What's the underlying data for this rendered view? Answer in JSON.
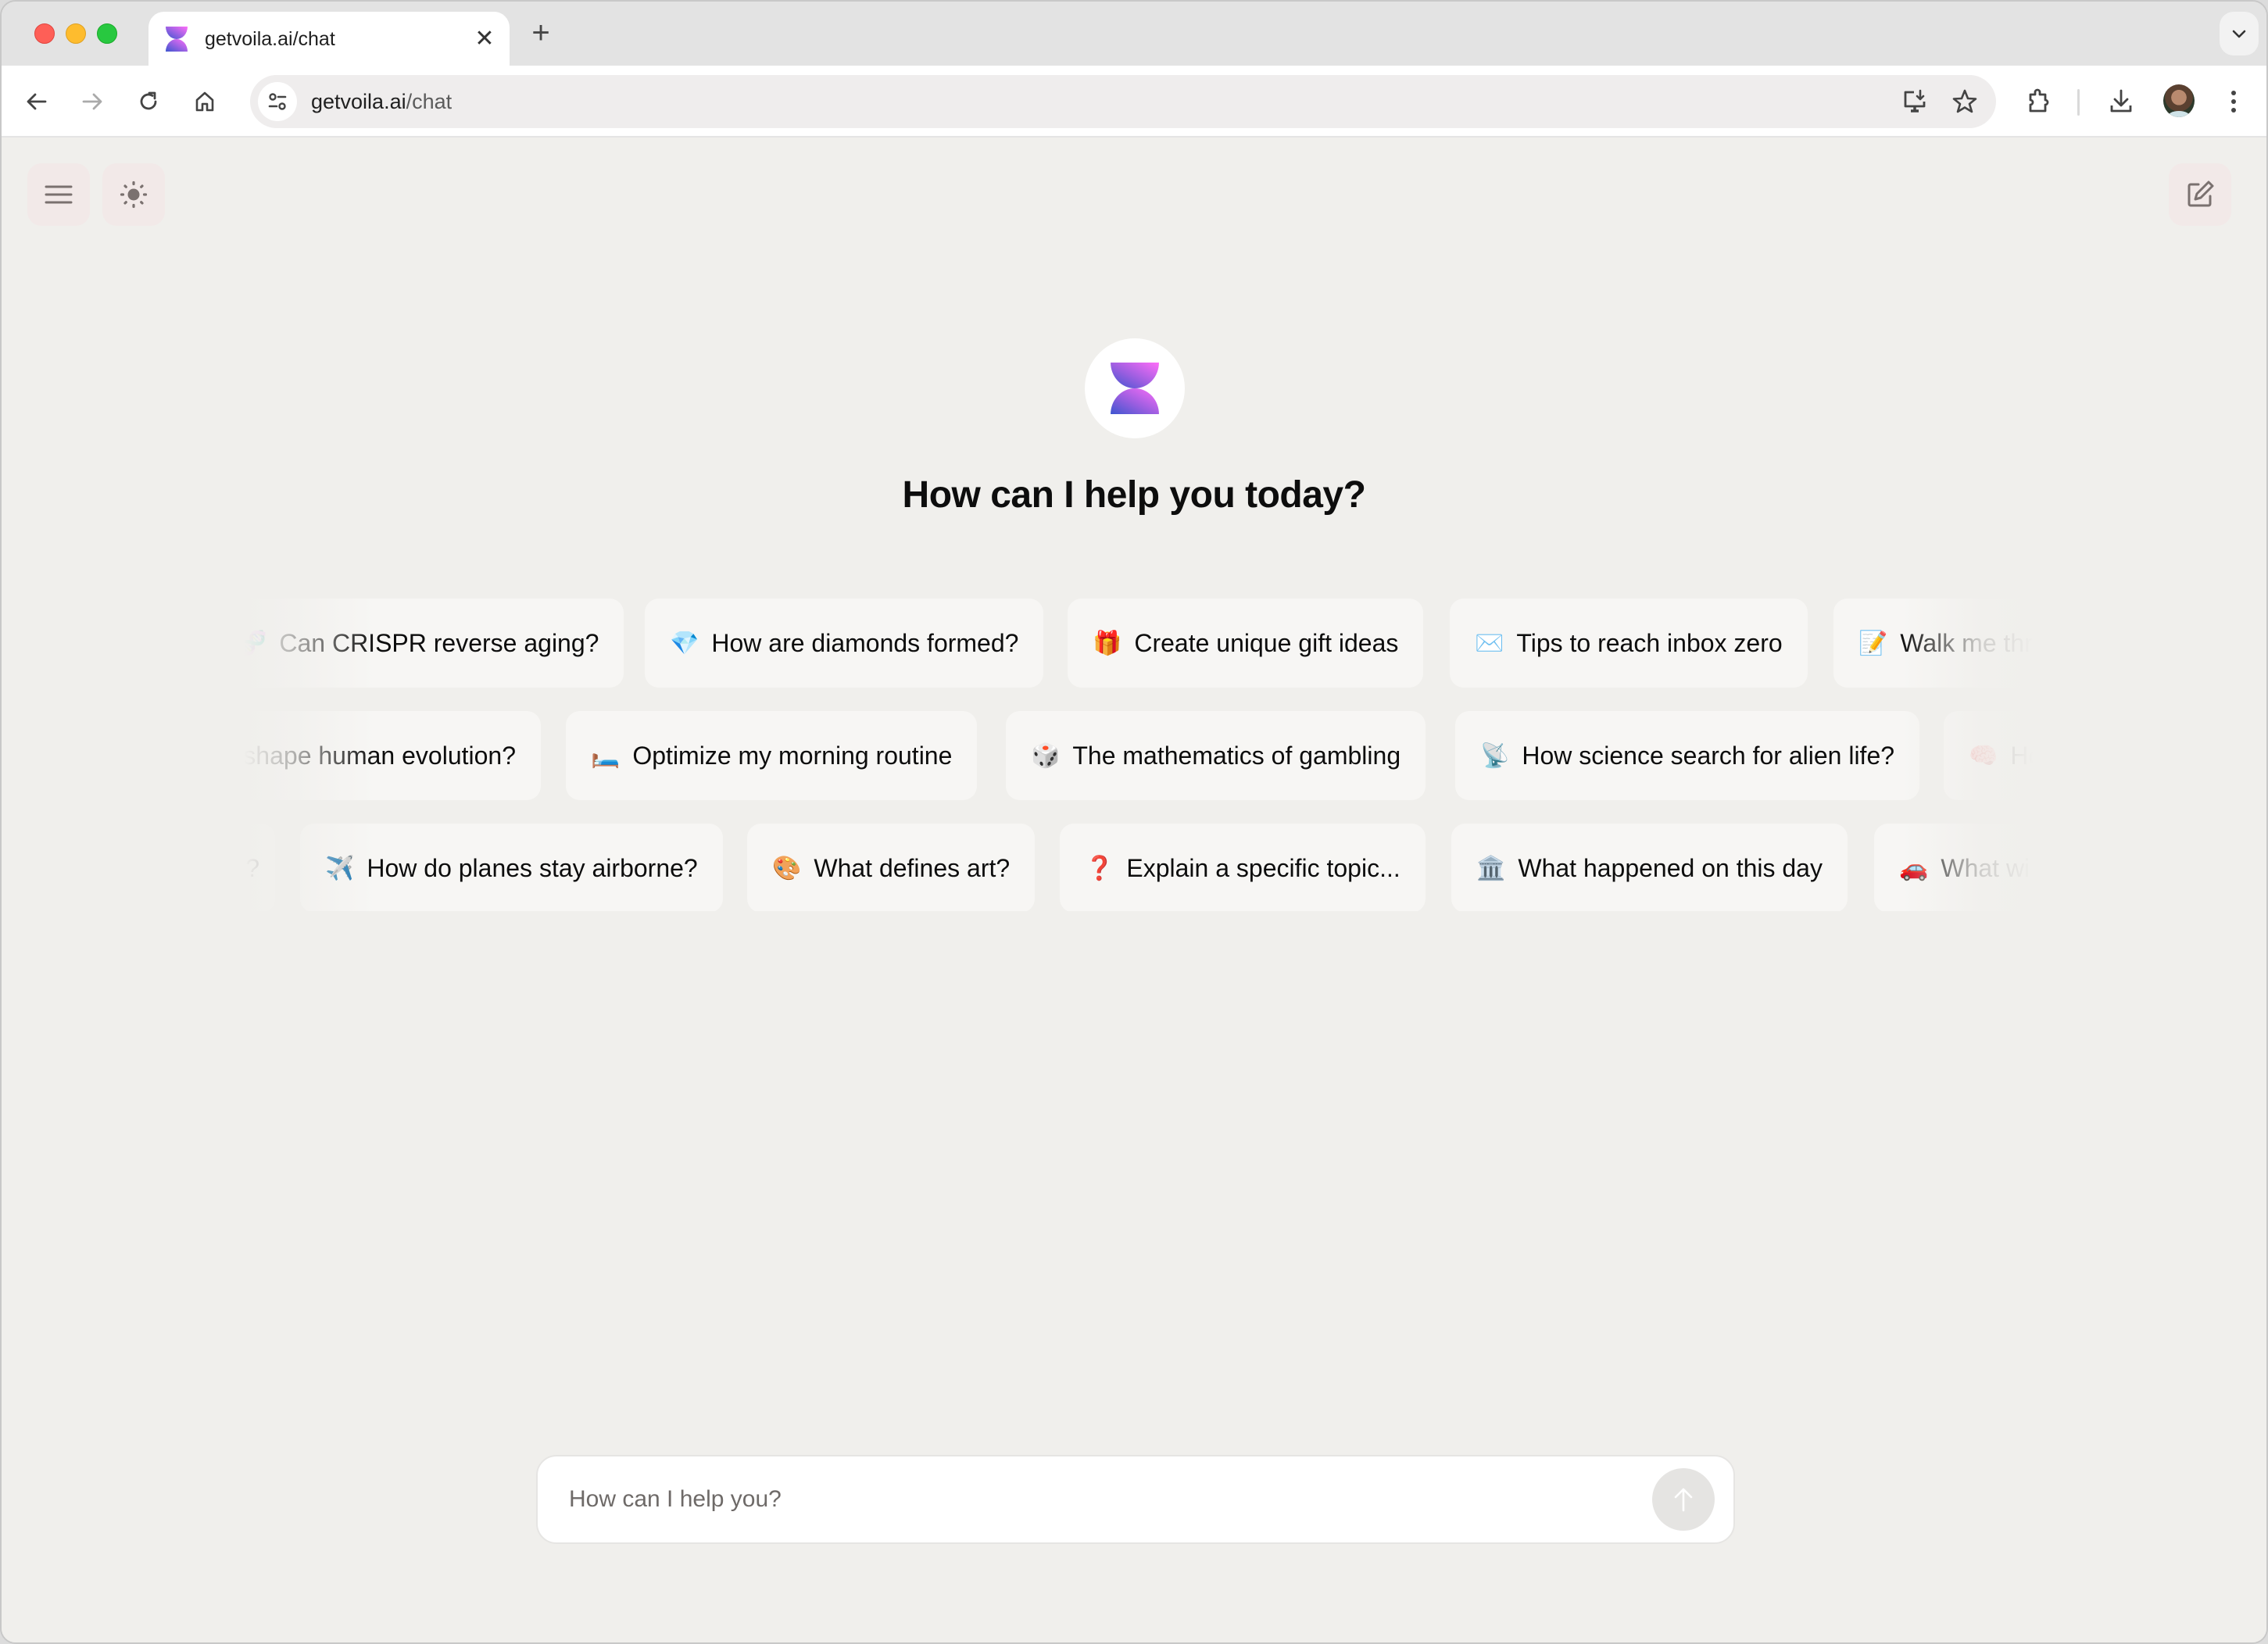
{
  "browser": {
    "tab": {
      "title": "getvoila.ai/chat",
      "favicon": "voila-logo-icon",
      "close_icon": "close-icon"
    },
    "new_tab_icon": "plus-icon",
    "tab_list_icon": "chevron-down-icon",
    "nav": {
      "back_icon": "arrow-left-icon",
      "forward_icon": "arrow-right-icon",
      "reload_icon": "reload-icon",
      "home_icon": "home-icon"
    },
    "address_bar": {
      "site_info_icon": "tune-icon",
      "host": "getvoila.ai",
      "path": "/chat"
    },
    "toolbar_icons": [
      "install-app-icon",
      "bookmark-star-icon",
      "extensions-icon",
      "download-icon",
      "profile-avatar",
      "more-vert-icon"
    ]
  },
  "app": {
    "top_left_buttons": [
      {
        "name": "menu",
        "icon": "hamburger-menu-icon"
      },
      {
        "name": "theme-toggle",
        "icon": "sun-icon"
      }
    ],
    "top_right_button": {
      "name": "new-chat",
      "icon": "edit-compose-icon"
    },
    "logo_icon": "voila-logo-icon",
    "heading": "How can I help you today?",
    "brand_colors": {
      "gradient_start": "#ff6ef8",
      "gradient_end": "#3d56d0"
    },
    "suggestion_rows": [
      [
        {
          "emoji": "🧬",
          "label": "Can CRISPR reverse aging?",
          "partial": "left"
        },
        {
          "emoji": "💎",
          "label": "How are diamonds formed?"
        },
        {
          "emoji": "🎁",
          "label": "Create unique gift ideas"
        },
        {
          "emoji": "✉️",
          "label": "Tips to reach inbox zero"
        },
        {
          "emoji": "📝",
          "label": "Walk me thr",
          "partial": "right"
        }
      ],
      [
        {
          "emoji": "",
          "label": "shape human evolution?",
          "partial": "left"
        },
        {
          "emoji": "🛏️",
          "label": "Optimize my morning routine"
        },
        {
          "emoji": "🎲",
          "label": "The mathematics of gambling"
        },
        {
          "emoji": "📡",
          "label": "How science search for alien life?"
        },
        {
          "emoji": "🧠",
          "label": "Ho",
          "partial": "right"
        }
      ],
      [
        {
          "emoji": "",
          "label": "?",
          "partial": "left"
        },
        {
          "emoji": "✈️",
          "label": "How do planes stay airborne?"
        },
        {
          "emoji": "🎨",
          "label": "What defines art?"
        },
        {
          "emoji": "❓",
          "label": "Explain a specific topic..."
        },
        {
          "emoji": "🏛️",
          "label": "What happened on this day"
        },
        {
          "emoji": "🚗",
          "label": "What wi",
          "partial": "right"
        }
      ]
    ],
    "composer": {
      "placeholder": "How can I help you?",
      "value": "",
      "send_icon": "arrow-up-icon"
    }
  }
}
